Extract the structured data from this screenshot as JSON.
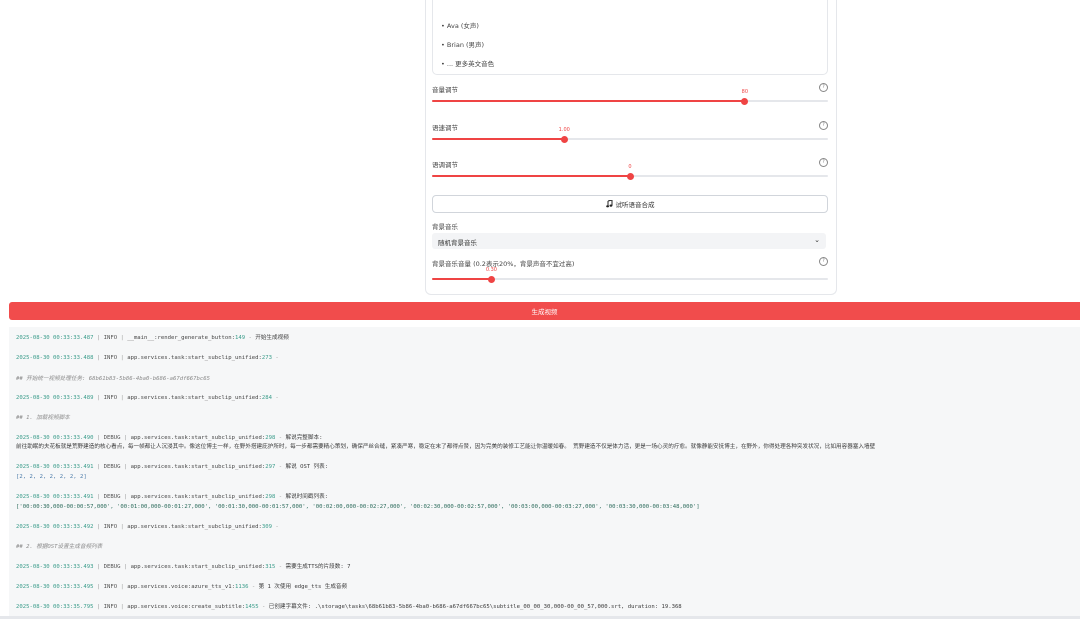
{
  "voices": [
    "• Ava (女声)",
    "• Brian (男声)",
    "• ... 更多英文音色"
  ],
  "sliders": [
    {
      "label": "音量调节",
      "value_text": "80",
      "fraction": 0.79
    },
    {
      "label": "语速调节",
      "value_text": "1.00",
      "fraction": 0.334
    },
    {
      "label": "语调调节",
      "value_text": "0",
      "fraction": 0.5
    }
  ],
  "test_button": {
    "icon": "music-note-icon",
    "label": "试听语音合成"
  },
  "bgm": {
    "label": "背景音乐",
    "selected": "随机背景音乐"
  },
  "bgm_volume": {
    "label": "背景音乐音量 (0.2表示20%，背景声音不宜过高)",
    "value_text": "0.30",
    "fraction": 0.15
  },
  "generate_button": {
    "label": "生成视频"
  },
  "colors": {
    "accent": "#ef4444",
    "button": "#f14c4c",
    "log_bg": "#f6f7f8",
    "timestamp": "#3a9c8a"
  },
  "logs": [
    {
      "ts": "2025-08-30 00:33:33.487",
      "level": "INFO",
      "module": "__main__:render_generate_button",
      "line": "149",
      "msg": "开始生成视频"
    },
    {
      "ts": "2025-08-30 00:33:33.488",
      "level": "INFO",
      "module": "app.services.task:start_subclip_unified",
      "line": "273",
      "msg": ""
    },
    {
      "md": "## 开始统一视频处理任务: 68b61b83-5b86-4ba0-b686-a67df667bc65"
    },
    {
      "ts": "2025-08-30 00:33:33.489",
      "level": "INFO",
      "module": "app.services.task:start_subclip_unified",
      "line": "284",
      "msg": ""
    },
    {
      "md": "## 1. 加载视频脚本"
    },
    {
      "ts": "2025-08-30 00:33:33.490",
      "level": "DEBUG",
      "module": "app.services.task:start_subclip_unified",
      "line": "298",
      "msg": "解说完整脚本:"
    },
    {
      "text": "前往助眠的夫花板就是荒野建造的核心看点，每一帧都让人沉浸其中。像这位博主一样，在野外搭建庇护所时，每一步都需要精心策划，确保严丝合缝，紧凑严寒，稳定在末了都得点赞，因为完美的装修工艺能让你温暖如春。 荒野建造不仅是体力活，更是一场心灵的疗愈。就像静能安抚博主，在野外，你得处理各种突发状况，比如用容器塞入墙壁"
    },
    {
      "ts": "2025-08-30 00:33:33.491",
      "level": "DEBUG",
      "module": "app.services.task:start_subclip_unified",
      "line": "297",
      "msg": "解说 OST 列表:"
    },
    {
      "arr": "[2, 2, 2, 2, 2, 2, 2]"
    },
    {
      "ts": "2025-08-30 00:33:33.491",
      "level": "DEBUG",
      "module": "app.services.task:start_subclip_unified",
      "line": "298",
      "msg": "解说时间戳列表:"
    },
    {
      "arr": "['00:00:30,000-00:00:57,000', '00:01:00,000-00:01:27,000', '00:01:30,000-00:01:57,000', '00:02:00,000-00:02:27,000', '00:02:30,000-00:02:57,000', '00:03:00,000-00:03:27,000', '00:03:30,000-00:03:48,000']"
    },
    {
      "ts": "2025-08-30 00:33:33.492",
      "level": "INFO",
      "module": "app.services.task:start_subclip_unified",
      "line": "309",
      "msg": ""
    },
    {
      "md": "## 2. 根据OST设置生成音频列表"
    },
    {
      "ts": "2025-08-30 00:33:33.493",
      "level": "DEBUG",
      "module": "app.services.task:start_subclip_unified",
      "line": "315",
      "msg": "需要生成TTS的片段数: 7"
    },
    {
      "ts": "2025-08-30 00:33:33.495",
      "level": "INFO",
      "module": "app.services.voice:azure_tts_v1",
      "line": "1136",
      "msg": "第 1 次使用 edge_tts 生成音频"
    },
    {
      "ts": "2025-08-30 00:33:35.795",
      "level": "INFO",
      "module": "app.services.voice:create_subtitle",
      "line": "1455",
      "msg": "已创建字幕文件: .\\storage\\tasks\\68b61b83-5b86-4ba0-b686-a67df667bc65\\subtitle_00_00_30,000-00_00_57,000.srt, duration: 19.368"
    }
  ]
}
